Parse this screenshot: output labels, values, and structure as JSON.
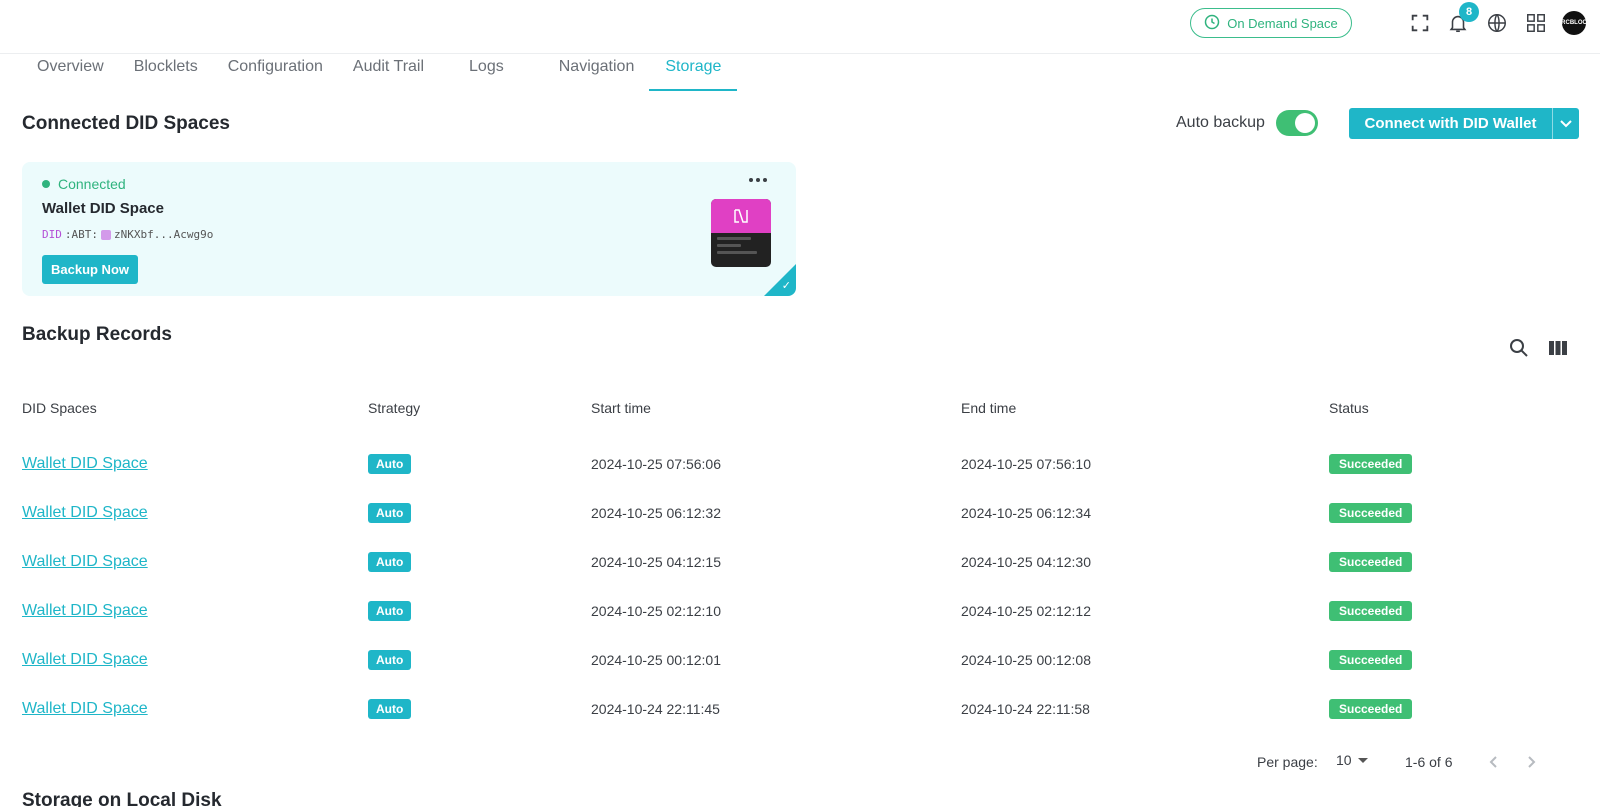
{
  "topbar": {
    "on_demand_label": "On Demand Space",
    "notification_count": "8",
    "avatar_text": "ARCBLOCK"
  },
  "tabs": [
    {
      "label": "Overview",
      "active": false
    },
    {
      "label": "Blocklets",
      "active": false
    },
    {
      "label": "Configuration",
      "active": false
    },
    {
      "label": "Audit Trail",
      "active": false
    },
    {
      "label": "Logs",
      "active": false
    },
    {
      "label": "Navigation",
      "active": false
    },
    {
      "label": "Storage",
      "active": true
    }
  ],
  "connected": {
    "title": "Connected DID Spaces",
    "auto_backup_label": "Auto backup",
    "auto_backup_on": true,
    "connect_label": "Connect with DID Wallet",
    "card": {
      "status": "Connected",
      "name": "Wallet DID Space",
      "did_prefix": "DID",
      "did_type": ":ABT:",
      "did_value": "zNKXbf...Acwg9o",
      "backup_label": "Backup Now"
    }
  },
  "records": {
    "title": "Backup Records",
    "columns": [
      "DID Spaces",
      "Strategy",
      "Start time",
      "End time",
      "Status"
    ],
    "rows": [
      {
        "space": "Wallet DID Space",
        "strategy": "Auto",
        "start": "2024-10-25 07:56:06",
        "end": "2024-10-25 07:56:10",
        "status": "Succeeded"
      },
      {
        "space": "Wallet DID Space",
        "strategy": "Auto",
        "start": "2024-10-25 06:12:32",
        "end": "2024-10-25 06:12:34",
        "status": "Succeeded"
      },
      {
        "space": "Wallet DID Space",
        "strategy": "Auto",
        "start": "2024-10-25 04:12:15",
        "end": "2024-10-25 04:12:30",
        "status": "Succeeded"
      },
      {
        "space": "Wallet DID Space",
        "strategy": "Auto",
        "start": "2024-10-25 02:12:10",
        "end": "2024-10-25 02:12:12",
        "status": "Succeeded"
      },
      {
        "space": "Wallet DID Space",
        "strategy": "Auto",
        "start": "2024-10-25 00:12:01",
        "end": "2024-10-25 00:12:08",
        "status": "Succeeded"
      },
      {
        "space": "Wallet DID Space",
        "strategy": "Auto",
        "start": "2024-10-24 22:11:45",
        "end": "2024-10-24 22:11:58",
        "status": "Succeeded"
      }
    ],
    "pagination": {
      "per_page_label": "Per page:",
      "per_page_value": "10",
      "range": "1-6 of 6"
    }
  },
  "local_disk": {
    "title": "Storage on Local Disk"
  },
  "colors": {
    "accent": "#1fb6c8",
    "success": "#3fbf74"
  }
}
